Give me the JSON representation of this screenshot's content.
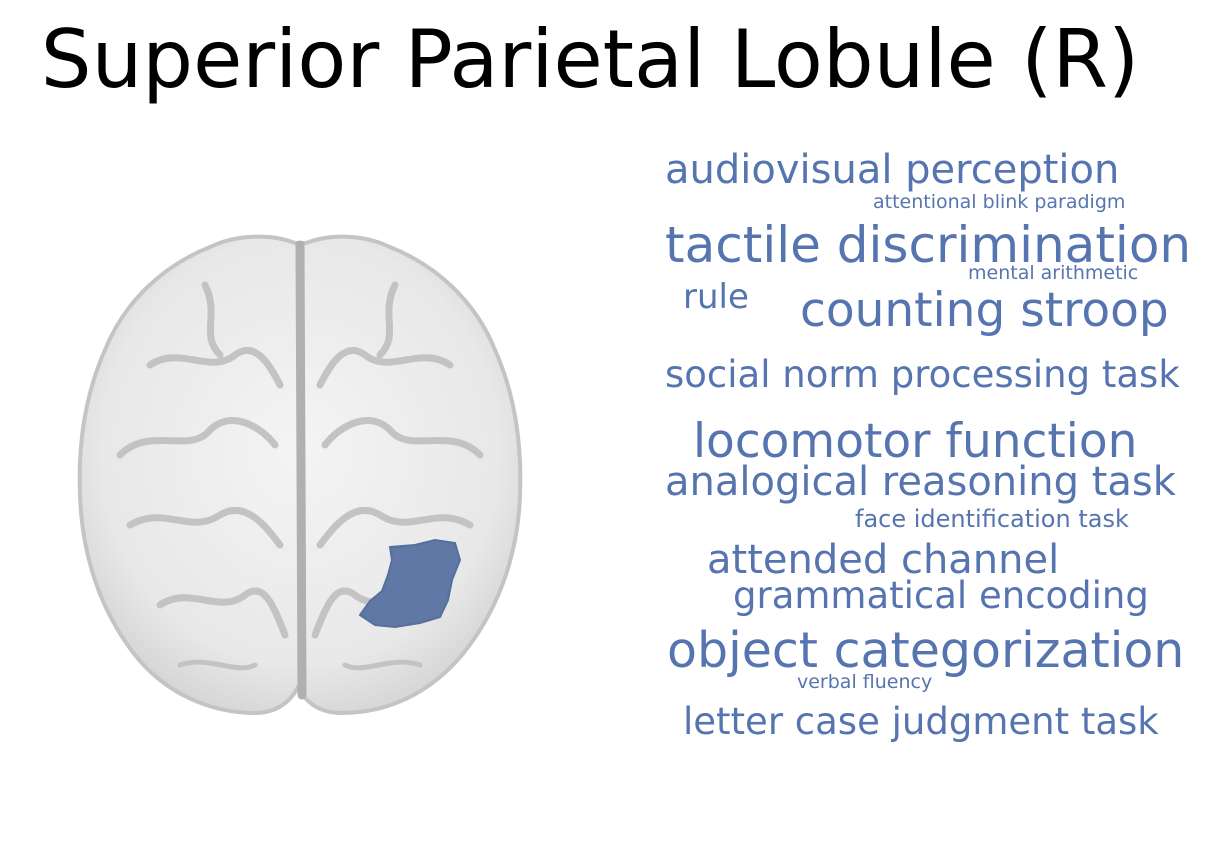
{
  "title": "Superior Parietal Lobule (R)",
  "colors": {
    "term": "#5675b0",
    "region": "#5f78a6",
    "brain_fill": "#e9e9e9",
    "brain_edge": "#cfcfcf",
    "sulcus": "#b8b8b8"
  },
  "brain": {
    "view": "axial",
    "highlight": "right superior parietal region"
  },
  "terms": [
    {
      "text": "audiovisual perception"
    },
    {
      "text": "attentional blink paradigm"
    },
    {
      "text": "tactile discrimination"
    },
    {
      "text": "mental arithmetic"
    },
    {
      "text": "rule"
    },
    {
      "text": "counting stroop"
    },
    {
      "text": "social norm processing task"
    },
    {
      "text": "locomotor function"
    },
    {
      "text": "analogical reasoning task"
    },
    {
      "text": "face identification task"
    },
    {
      "text": "attended channel"
    },
    {
      "text": "grammatical encoding"
    },
    {
      "text": "object categorization"
    },
    {
      "text": "verbal fluency"
    },
    {
      "text": "letter case judgment task"
    }
  ]
}
